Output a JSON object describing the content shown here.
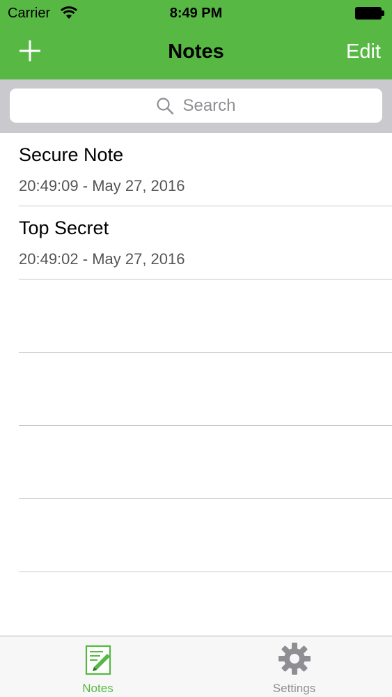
{
  "status_bar": {
    "carrier": "Carrier",
    "time": "8:49 PM",
    "wifi_icon": "wifi-icon",
    "battery_icon": "battery-icon"
  },
  "nav": {
    "title": "Notes",
    "add_icon": "plus-icon",
    "edit_label": "Edit"
  },
  "search": {
    "placeholder": "Search",
    "icon": "search-icon"
  },
  "notes": [
    {
      "title": "Secure Note",
      "timestamp": "20:49:09 - May 27, 2016"
    },
    {
      "title": "Top Secret",
      "timestamp": "20:49:02 - May 27, 2016"
    }
  ],
  "tab_bar": {
    "tabs": [
      {
        "label": "Notes",
        "icon": "note-pencil-icon",
        "selected": true
      },
      {
        "label": "Settings",
        "icon": "gear-icon",
        "selected": false
      }
    ]
  },
  "colors": {
    "accent": "#57b844",
    "search_bg": "#c9c9ce",
    "separator": "#c8c7cc"
  }
}
